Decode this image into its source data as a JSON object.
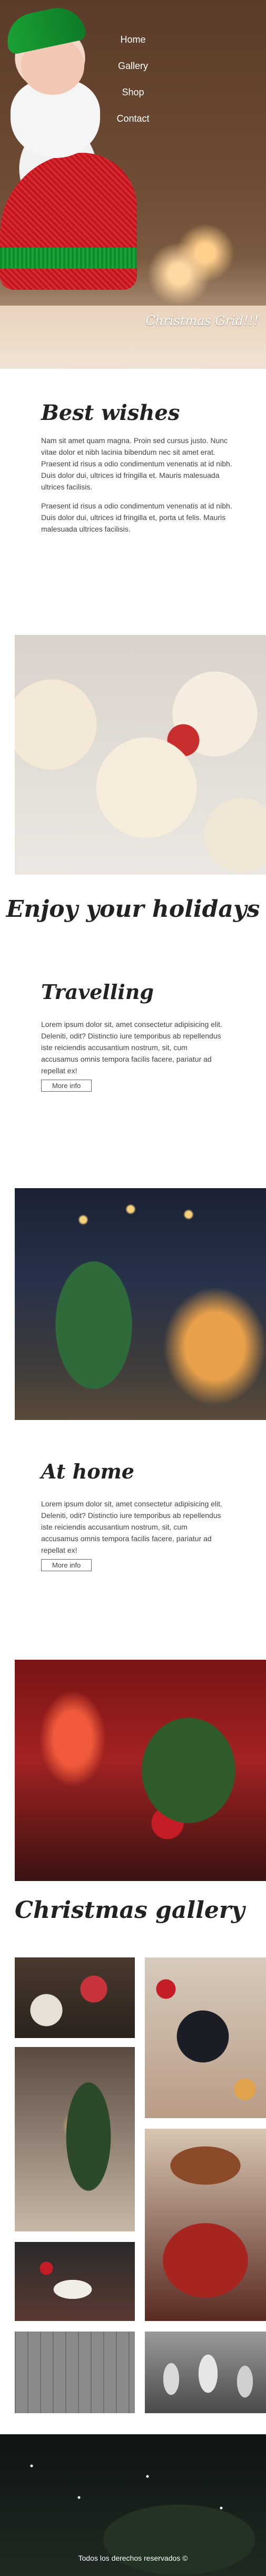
{
  "nav": {
    "items": [
      "Home",
      "Gallery",
      "Shop",
      "Contact"
    ]
  },
  "hero": {
    "caption": "Christmas Grid!!!"
  },
  "best_wishes": {
    "title": "Best wishes",
    "paragraph1": "Nam sit amet quam magna. Proin sed cursus justo. Nunc vitae dolor et nibh lacinia bibendum nec sit amet erat. Praesent id risus a odio condimentum venenatis at id nibh. Duis dolor dui, ultrices id fringilla et. Mauris malesuada ultrices facilisis.",
    "paragraph2": "Praesent id risus a odio condimentum venenatis at id nibh. Duis dolor dui, ultrices id fringilla et, porta ut felis. Mauris malesuada ultrices facilisis."
  },
  "enjoy": {
    "title": "Enjoy your holidays"
  },
  "travelling": {
    "title": "Travelling",
    "text": "Lorem ipsum dolor sit, amet consectetur adipisicing elit. Deleniti, odit? Distinctio iure temporibus ab repellendus iste reiciendis accusantium nostrum, sit, cum accusamus omnis tempora facilis facere, pariatur ad repellat ex!",
    "button": "More info"
  },
  "at_home": {
    "title": "At home",
    "text": "Lorem ipsum dolor sit, amet consectetur adipisicing elit. Deleniti, odit? Distinctio iure temporibus ab repellendus iste reiciendis accusantium nostrum, sit, cum accusamus omnis tempora facilis facere, pariatur ad repellat ex!",
    "button": "More info"
  },
  "gallery": {
    "title": "Christmas gallery"
  },
  "footer": {
    "text": "Todos los derechos reservados ©"
  }
}
